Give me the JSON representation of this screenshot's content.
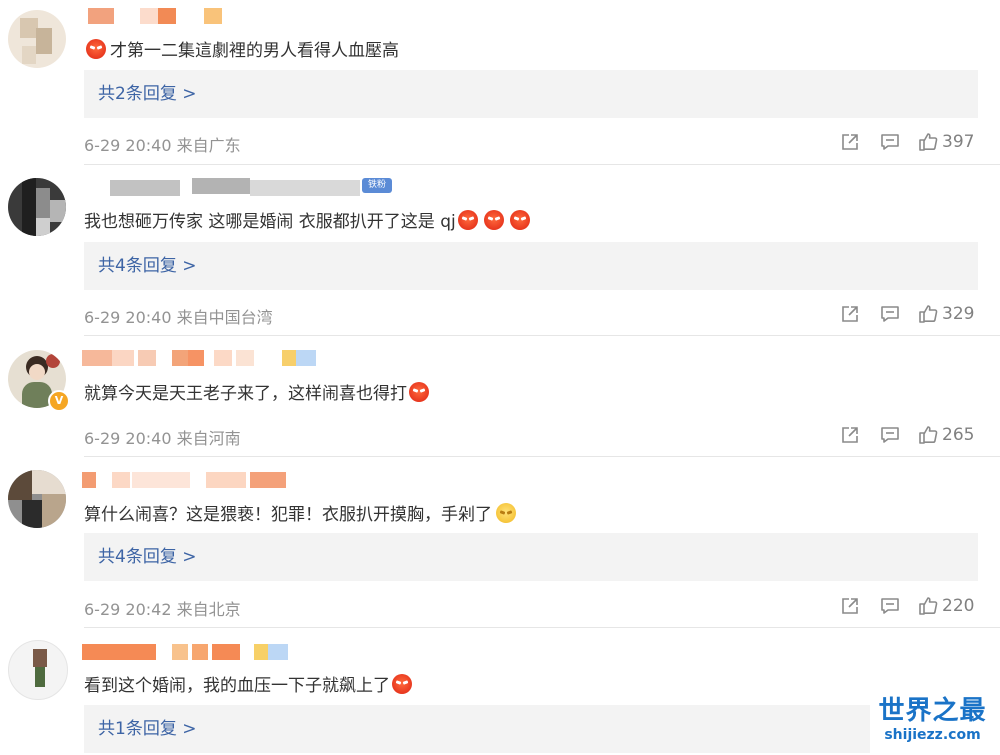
{
  "comments": [
    {
      "text": "才第一二集這劇裡的男人看得人血壓高",
      "replies": "共2条回复 >",
      "timestamp": "6-29 20:40 来自广东",
      "likes": "397"
    },
    {
      "text": "我也想砸万传家 这哪是婚闹 衣服都扒开了这是 qj",
      "replies": "共4条回复 >",
      "timestamp": "6-29 20:40 来自中国台湾",
      "likes": "329",
      "badge": "铁粉"
    },
    {
      "text": "就算今天是天王老子来了，这样闹喜也得打",
      "timestamp": "6-29 20:40 来自河南",
      "likes": "265"
    },
    {
      "text": "算什么闹喜？这是猥亵！犯罪！衣服扒开摸胸，手剁了",
      "replies": "共4条回复 >",
      "timestamp": "6-29 20:42 来自北京",
      "likes": "220"
    },
    {
      "text": "看到这个婚闹，我的血压一下子就飙上了",
      "replies": "共1条回复 >"
    }
  ],
  "watermark": {
    "title": "世界之最",
    "url": "shijiezz.com"
  },
  "icons": {
    "share": "share-icon",
    "comment": "comment-icon",
    "like": "thumbs-up-icon",
    "emoji_angry": "angry-face-emoji",
    "emoji_sweat": "sweat-face-emoji",
    "verified": "verified-badge-icon"
  },
  "colors": {
    "reply_link": "#3d64a5",
    "meta_text": "#939393",
    "reply_bg": "#f3f3f3",
    "watermark": "#1a73c7"
  }
}
